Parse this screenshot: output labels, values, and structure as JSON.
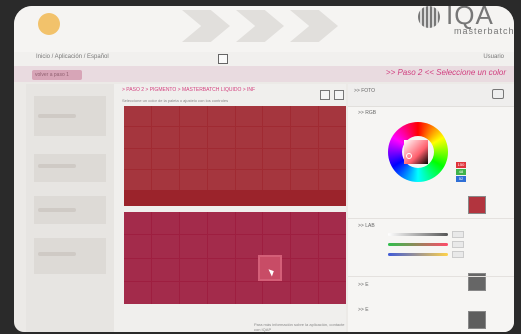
{
  "header": {
    "brand": "IQA",
    "brand_sub": "masterbatch"
  },
  "menubar": {
    "left_text": "Inicio / Aplicación / Español",
    "right_text": "Usuario"
  },
  "step_bar": {
    "back_label": "volver a paso 1",
    "step_text": ">> Paso 2 << Seleccione un color"
  },
  "main": {
    "breadcrumb": "> PASO 2 > PIGMENTO > MASTERBATCH LIQUIDO > INF",
    "subtitle": "Seleccione un color de la paleta o ajustelo con los controles"
  },
  "right_panel": {
    "header_label": ">> FOTO",
    "rgb_label": ">> RGB",
    "rgb_badges": [
      "150",
      "48",
      "52"
    ],
    "lab_label": ">> LAB",
    "e_label": ">> E",
    "e2_label": ">> E"
  },
  "footer": {
    "text": "Para más información sobre la aplicación, contacte con IQAP"
  },
  "colors": {
    "accent_pink": "#d13e7f",
    "selected_color": "#b2343e"
  }
}
